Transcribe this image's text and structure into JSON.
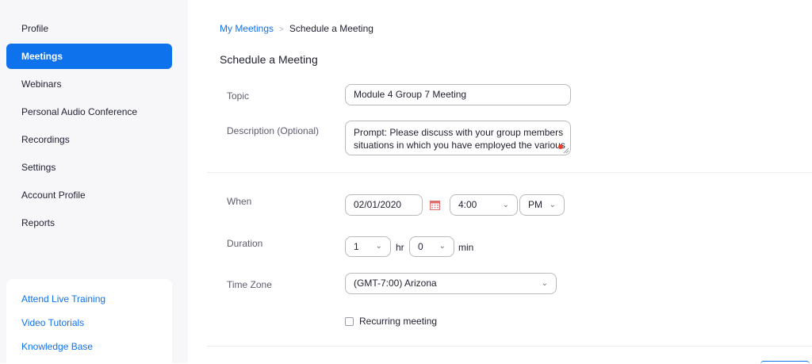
{
  "sidebar": {
    "items": [
      {
        "label": "Profile"
      },
      {
        "label": "Meetings"
      },
      {
        "label": "Webinars"
      },
      {
        "label": "Personal Audio Conference"
      },
      {
        "label": "Recordings"
      },
      {
        "label": "Settings"
      },
      {
        "label": "Account Profile"
      },
      {
        "label": "Reports"
      }
    ],
    "help_links": [
      {
        "label": "Attend Live Training"
      },
      {
        "label": "Video Tutorials"
      },
      {
        "label": "Knowledge Base"
      }
    ]
  },
  "breadcrumb": {
    "parent": "My Meetings",
    "separator": ">",
    "current": "Schedule a Meeting"
  },
  "page_title": "Schedule a Meeting",
  "form": {
    "topic": {
      "label": "Topic",
      "value": "Module 4 Group 7 Meeting"
    },
    "description": {
      "label": "Description (Optional)",
      "line1": "Prompt: Please discuss with your group members",
      "line2": "situations in which you have employed the various"
    },
    "when": {
      "label": "When",
      "date": "02/01/2020",
      "time": "4:00",
      "ampm": "PM"
    },
    "duration": {
      "label": "Duration",
      "hours": "1",
      "hr_unit": "hr",
      "minutes": "0",
      "min_unit": "min"
    },
    "timezone": {
      "label": "Time Zone",
      "value": "(GMT-7:00) Arizona"
    },
    "recurring": {
      "label": "Recurring meeting",
      "checked": false
    }
  },
  "colors": {
    "accent": "#0e72ed",
    "sidebar_bg": "#f7f7fa",
    "border": "#bababa"
  }
}
